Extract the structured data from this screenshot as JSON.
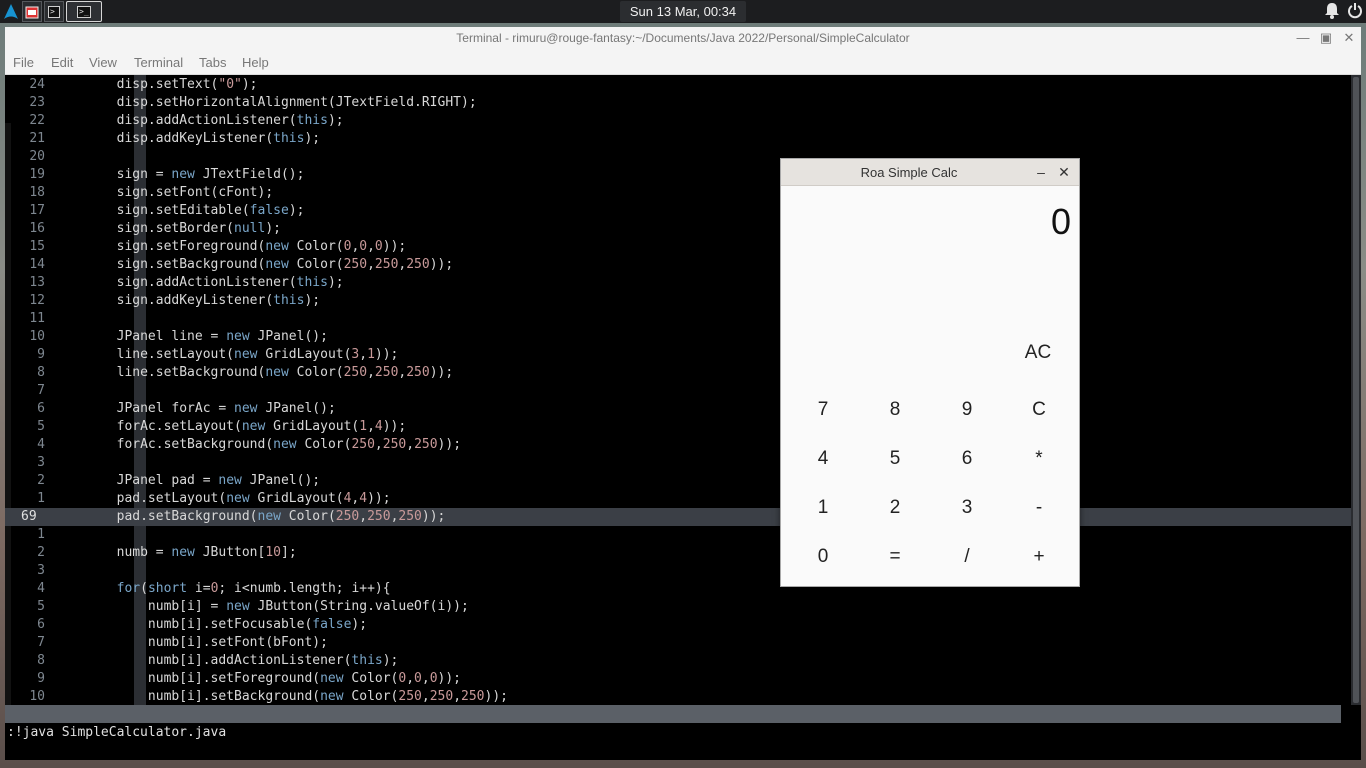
{
  "panel": {
    "clock": "Sun 13 Mar, 00:34",
    "launchers": [
      "app-menu",
      "file-manager",
      "terminal",
      "terminal-active"
    ]
  },
  "terminal": {
    "title": "Terminal - rimuru@rouge-fantasy:~/Documents/Java 2022/Personal/SimpleCalculator",
    "menu": [
      "File",
      "Edit",
      "View",
      "Terminal",
      "Tabs",
      "Help"
    ],
    "current_line_number": "69",
    "lines": [
      {
        "n": "24",
        "code": "disp.setText(\"0\");"
      },
      {
        "n": "23",
        "code": "disp.setHorizontalAlignment(JTextField.RIGHT);"
      },
      {
        "n": "22",
        "code": "disp.addActionListener(this);"
      },
      {
        "n": "21",
        "code": "disp.addKeyListener(this);"
      },
      {
        "n": "20",
        "code": ""
      },
      {
        "n": "19",
        "code": "sign = new JTextField();"
      },
      {
        "n": "18",
        "code": "sign.setFont(cFont);"
      },
      {
        "n": "17",
        "code": "sign.setEditable(false);"
      },
      {
        "n": "16",
        "code": "sign.setBorder(null);"
      },
      {
        "n": "15",
        "code": "sign.setForeground(new Color(0,0,0));"
      },
      {
        "n": "14",
        "code": "sign.setBackground(new Color(250,250,250));"
      },
      {
        "n": "13",
        "code": "sign.addActionListener(this);"
      },
      {
        "n": "12",
        "code": "sign.addKeyListener(this);"
      },
      {
        "n": "11",
        "code": ""
      },
      {
        "n": "10",
        "code": "JPanel line = new JPanel();"
      },
      {
        "n": "9",
        "code": "line.setLayout(new GridLayout(3,1));"
      },
      {
        "n": "8",
        "code": "line.setBackground(new Color(250,250,250));"
      },
      {
        "n": "7",
        "code": ""
      },
      {
        "n": "6",
        "code": "JPanel forAc = new JPanel();"
      },
      {
        "n": "5",
        "code": "forAc.setLayout(new GridLayout(1,4));"
      },
      {
        "n": "4",
        "code": "forAc.setBackground(new Color(250,250,250));"
      },
      {
        "n": "3",
        "code": ""
      },
      {
        "n": "2",
        "code": "JPanel pad = new JPanel();"
      },
      {
        "n": "1",
        "code": "pad.setLayout(new GridLayout(4,4));"
      },
      {
        "n": "69",
        "code": "pad.setBackground(new Color(250,250,250));"
      },
      {
        "n": "1",
        "code": ""
      },
      {
        "n": "2",
        "code": "numb = new JButton[10];"
      },
      {
        "n": "3",
        "code": ""
      },
      {
        "n": "4",
        "code": "for(short i=0; i<numb.length; i++){"
      },
      {
        "n": "5",
        "code": "    numb[i] = new JButton(String.valueOf(i));"
      },
      {
        "n": "6",
        "code": "    numb[i].setFocusable(false);"
      },
      {
        "n": "7",
        "code": "    numb[i].setFont(bFont);"
      },
      {
        "n": "8",
        "code": "    numb[i].addActionListener(this);"
      },
      {
        "n": "9",
        "code": "    numb[i].setForeground(new Color(0,0,0));"
      },
      {
        "n": "10",
        "code": "    numb[i].setBackground(new Color(250,250,250));"
      }
    ],
    "command": ":!java SimpleCalculator.java"
  },
  "calculator": {
    "title": "Roa Simple Calc",
    "display": "0",
    "ac_label": "AC",
    "keys": [
      [
        "7",
        "8",
        "9",
        "C"
      ],
      [
        "4",
        "5",
        "6",
        "*"
      ],
      [
        "1",
        "2",
        "3",
        "-"
      ],
      [
        "0",
        "=",
        "/",
        "+"
      ]
    ]
  },
  "colors": {
    "keyword": "#7aa6c9",
    "number": "#c99a9a",
    "current_line": "#3b3f46"
  }
}
